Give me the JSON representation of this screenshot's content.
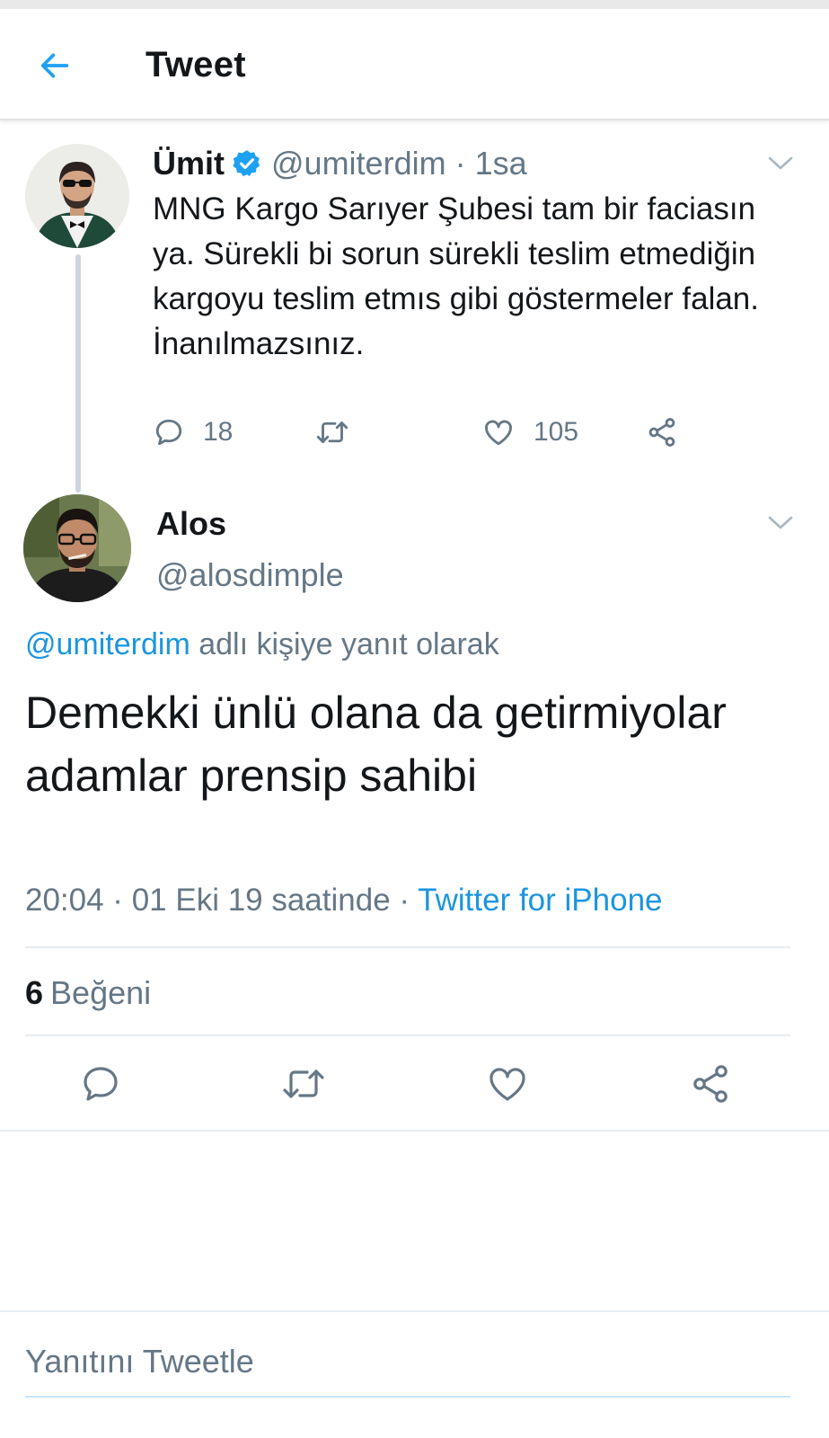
{
  "header": {
    "title": "Tweet",
    "back_icon": "arrow-left-icon"
  },
  "colors": {
    "accent": "#1da1f2",
    "link": "#1b95e0",
    "text": "#14171a",
    "secondary": "#657786",
    "divider": "#e6ecf0"
  },
  "parent_tweet": {
    "name": "Ümit",
    "verified": true,
    "handle": "@umiterdim",
    "separator": "·",
    "time": "1sa",
    "text": "MNG Kargo Sarıyer Şubesi tam bir faciasın ya. Sürekli bi sorun sürekli teslim etmediğin kargoyu teslim etmıs gibi göstermeler falan. İnanılmazsınız.",
    "reply_count": "18",
    "like_count": "105"
  },
  "main_tweet": {
    "name": "Alos",
    "handle": "@alosdimple",
    "reply_to_mention": "@umiterdim",
    "reply_to_suffix": " adlı kişiye yanıt olarak",
    "text": "Demekki ünlü olana da getirmiyolar adamlar prensip sahibi",
    "timestamp": "20:04 · 01 Eki 19 saatinde",
    "meta_separator": " · ",
    "source": "Twitter for iPhone",
    "like_count": "6",
    "like_label": "Beğeni"
  },
  "compose": {
    "placeholder": "Yanıtını Tweetle"
  }
}
